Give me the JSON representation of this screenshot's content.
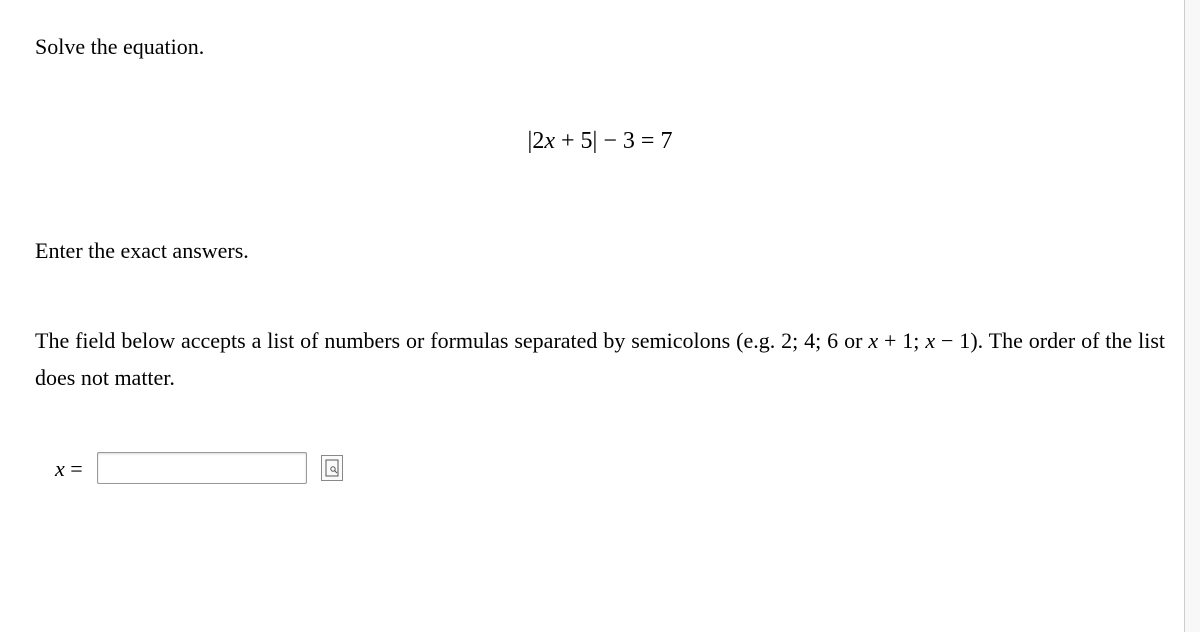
{
  "problem": {
    "instruction": "Solve the equation.",
    "equation_display": "|2x + 5| − 3 = 7",
    "equation_parts": {
      "abs_open": "|",
      "coef": "2",
      "var1": "x",
      "plus": " + ",
      "const1": "5",
      "abs_close": "|",
      "minus": " − ",
      "const2": "3",
      "eq": " = ",
      "rhs": "7"
    },
    "enter_instruction": "Enter the exact answers.",
    "hint_pre": "The field below accepts a list of numbers or formulas separated by semicolons (e.g. ",
    "hint_example1": "2; 4; 6",
    "hint_or": " or ",
    "hint_example2_p1": "x",
    "hint_example2_p2": " + 1; ",
    "hint_example2_p3": "x",
    "hint_example2_p4": " − 1",
    "hint_post": "). The order of the list does not matter."
  },
  "answer": {
    "label_var": "x",
    "label_eq": " =",
    "input_value": ""
  }
}
